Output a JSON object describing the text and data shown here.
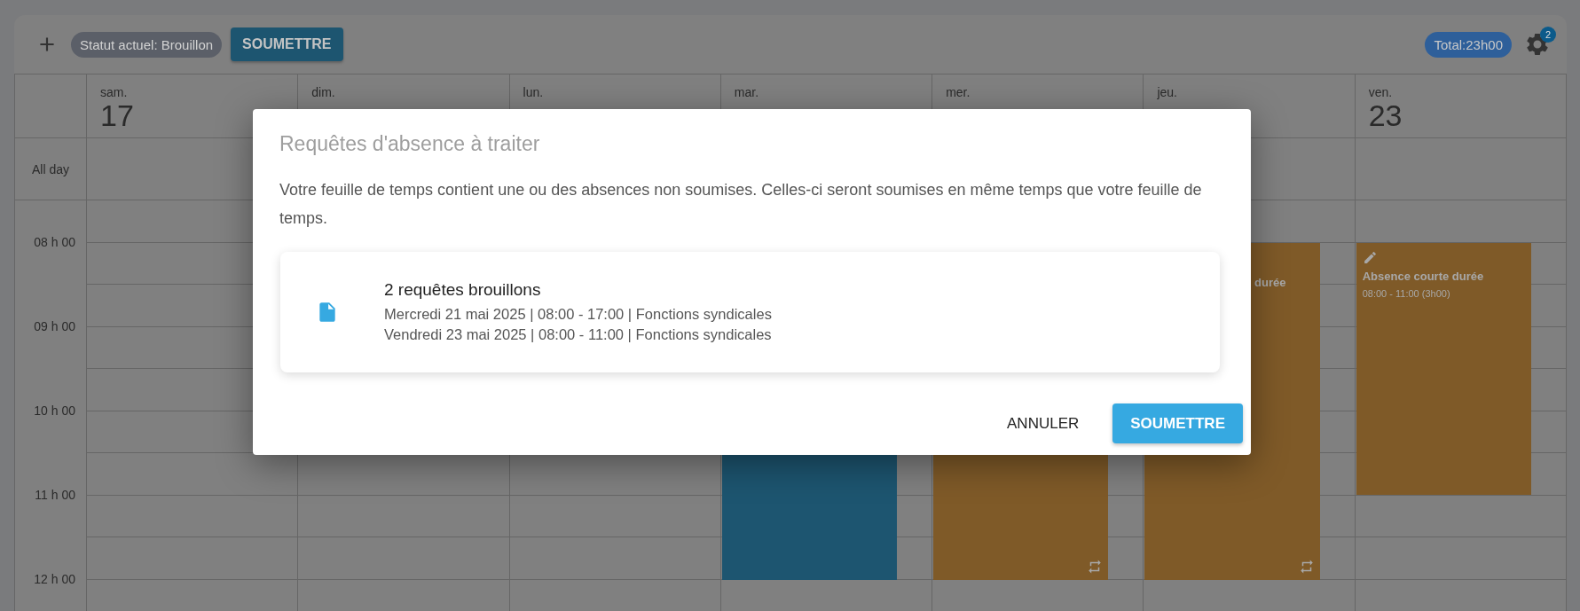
{
  "toolbar": {
    "status": "Statut actuel: Brouillon",
    "submit": "SOUMETTRE",
    "total": "Total:23h00",
    "settings_badge": "2"
  },
  "calendar": {
    "all_day_label": "All day",
    "days": [
      {
        "name": "sam.",
        "number": "17"
      },
      {
        "name": "dim."
      },
      {
        "name": "lun."
      },
      {
        "name": "mar.",
        "events": [
          {
            "kind": "long",
            "color": "#1d5570"
          }
        ]
      },
      {
        "name": "mer.",
        "events": [
          {
            "kind": "long",
            "color": "#7f5a28"
          }
        ]
      },
      {
        "name": "jeu.",
        "events": [
          {
            "kind": "long",
            "color": "#7f5a28",
            "title": "durée",
            "partial": true
          }
        ]
      },
      {
        "name": "ven.",
        "number": "23",
        "events": [
          {
            "kind": "short",
            "color": "#7f5a28",
            "title": "Absence courte durée",
            "time": "08:00 - 11:00 (3h00)",
            "partial": false
          }
        ]
      }
    ],
    "hours": [
      "08 h 00",
      "09 h 00",
      "10 h 00",
      "11 h 00",
      "12 h 00"
    ]
  },
  "dialog": {
    "title": "Requêtes d'absence à traiter",
    "message": "Votre feuille de temps contient une ou des absences non soumises. Celles-ci seront soumises en même temps que votre feuille de temps.",
    "card": {
      "title": "2 requêtes brouillons",
      "lines": [
        "Mercredi 21 mai 2025 | 08:00 - 17:00 | Fonctions syndicales",
        "Vendredi 23 mai 2025 | 08:00 - 11:00 | Fonctions syndicales"
      ]
    },
    "buttons": [
      {
        "label": "ANNULER",
        "kind": "text"
      },
      {
        "label": "SOUMETTRE",
        "kind": "primary"
      }
    ]
  }
}
